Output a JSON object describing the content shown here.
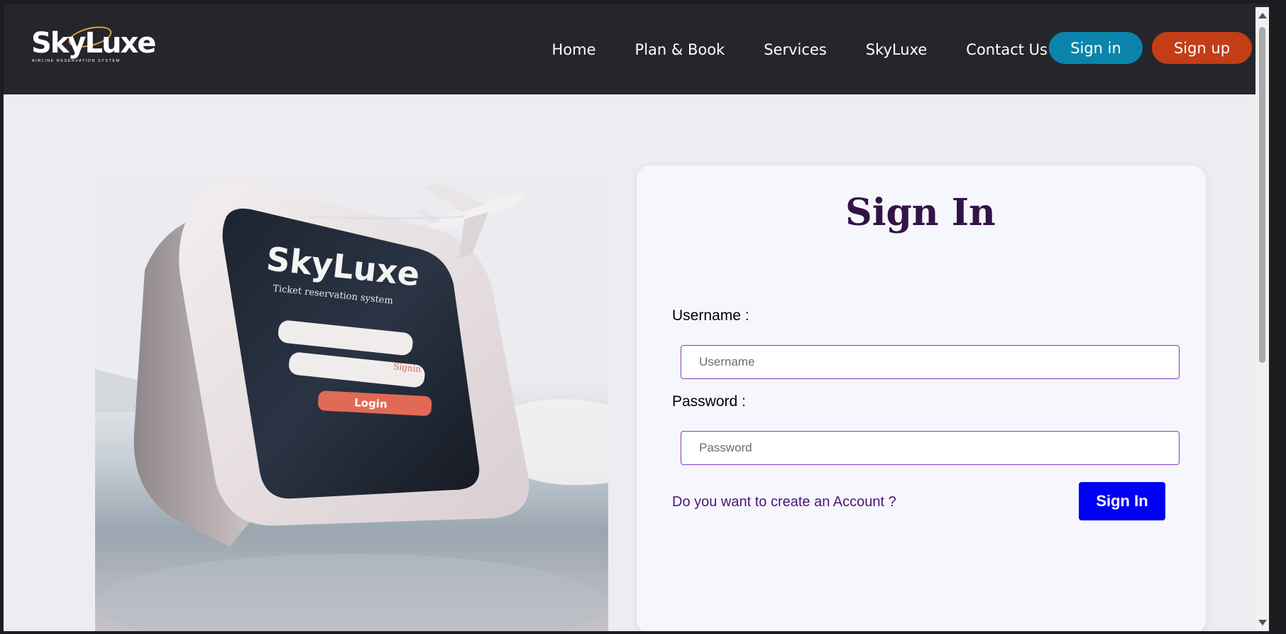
{
  "brand": {
    "name": "SkyLuxe",
    "tagline": "AIRLINE    RESERVATION  SYSTEM"
  },
  "nav": {
    "links": [
      "Home",
      "Plan & Book",
      "Services",
      "SkyLuxe",
      "Contact Us"
    ],
    "signin_label": "Sign in",
    "signup_label": "Sign up"
  },
  "illustration": {
    "brand": "SkyLuxe",
    "subtitle": "Ticket reservation system",
    "field_hint": "Signin",
    "button": "Login"
  },
  "form": {
    "title": "Sign In",
    "username_label": "Username :",
    "username_placeholder": "Username",
    "password_label": "Password :",
    "password_placeholder": "Password",
    "create_account_link": "Do you want to create an Account ?",
    "submit_label": "Sign In"
  },
  "colors": {
    "navbar": "#25262b",
    "signin_button": "#0b84ab",
    "signup_button": "#c33d16",
    "title": "#331346",
    "submit": "#0000f5"
  }
}
